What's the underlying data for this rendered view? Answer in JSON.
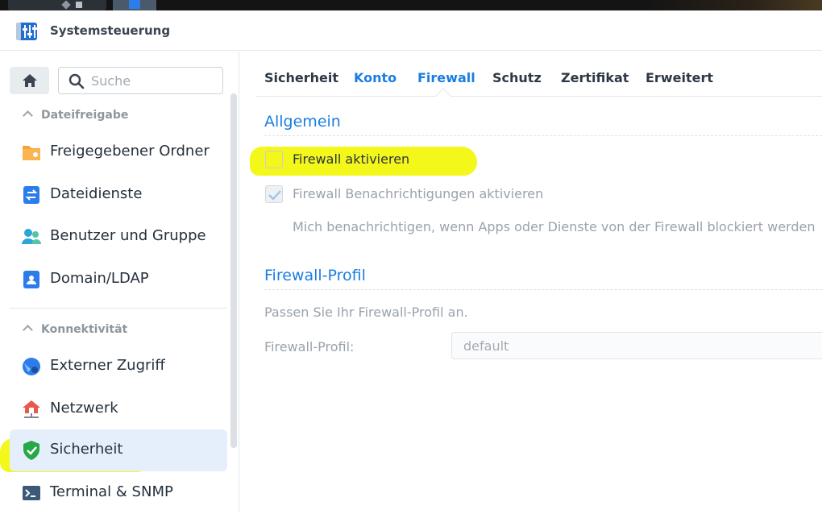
{
  "window": {
    "title": "Systemsteuerung"
  },
  "sidebar": {
    "search_placeholder": "Suche",
    "groups": [
      {
        "label": "Dateifreigabe"
      },
      {
        "label": "Konnektivität"
      }
    ],
    "items": [
      {
        "label": "Freigegebener Ordner",
        "icon": "folder-share-icon"
      },
      {
        "label": "Dateidienste",
        "icon": "file-services-icon"
      },
      {
        "label": "Benutzer und Gruppe",
        "icon": "users-icon"
      },
      {
        "label": "Domain/LDAP",
        "icon": "domain-ldap-icon"
      },
      {
        "label": "Externer Zugriff",
        "icon": "external-access-icon"
      },
      {
        "label": "Netzwerk",
        "icon": "network-icon"
      },
      {
        "label": "Sicherheit",
        "icon": "shield-icon",
        "active": true
      },
      {
        "label": "Terminal & SNMP",
        "icon": "terminal-icon"
      }
    ]
  },
  "tabs": [
    {
      "label": "Sicherheit"
    },
    {
      "label": "Konto"
    },
    {
      "label": "Firewall",
      "active": true
    },
    {
      "label": "Schutz"
    },
    {
      "label": "Zertifikat"
    },
    {
      "label": "Erweitert"
    }
  ],
  "general": {
    "title": "Allgemein",
    "enable_firewall": {
      "label": "Firewall aktivieren",
      "checked": false
    },
    "notifications": {
      "label": "Firewall Benachrichtigungen aktivieren",
      "checked": true,
      "disabled": true
    },
    "notify_desc": "Mich benachrichtigen, wenn Apps oder Dienste von der Firewall blockiert werden"
  },
  "profile": {
    "title": "Firewall-Profil",
    "desc": "Passen Sie Ihr Firewall-Profil an.",
    "field_label": "Firewall-Profil:",
    "value": "default"
  },
  "colors": {
    "accent": "#1a7ee0",
    "highlight": "#f2f70e",
    "active_bg": "#e4effb"
  }
}
